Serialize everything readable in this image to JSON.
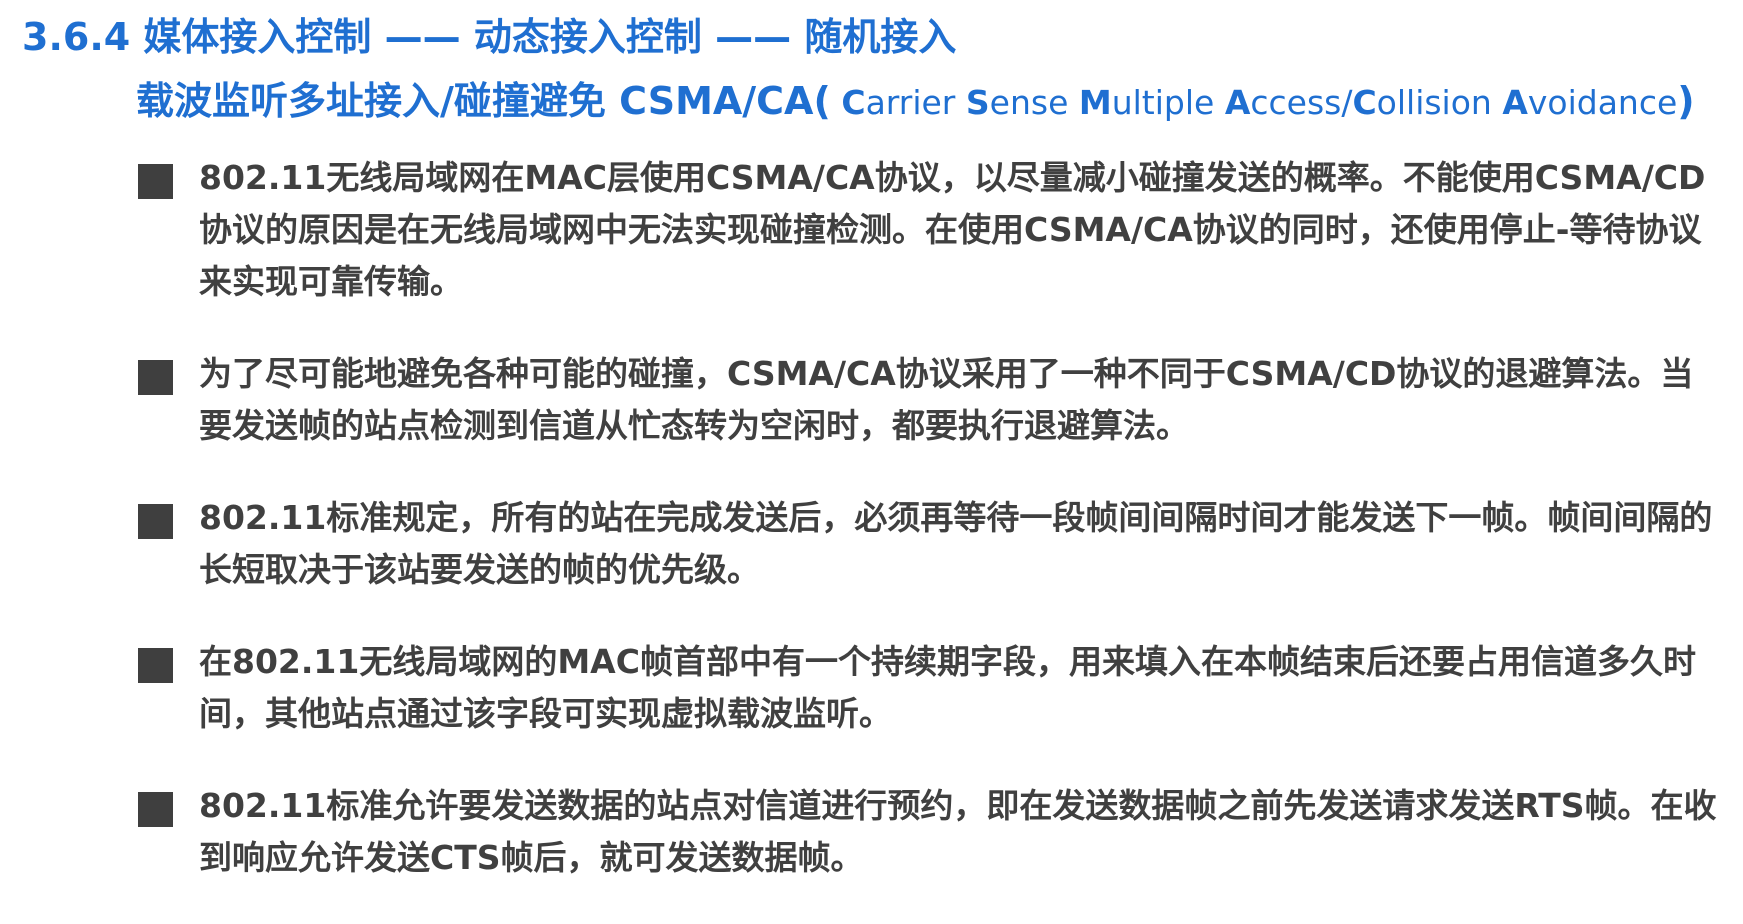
{
  "title": {
    "line1": "3.6.4 媒体接入控制 —— 动态接入控制 —— 随机接入",
    "line2_main": "载波监听多址接入/碰撞避免 CSMA/CA(",
    "line2_expansion": [
      {
        "initial": "C",
        "rest": "arrier "
      },
      {
        "initial": "S",
        "rest": "ense "
      },
      {
        "initial": "M",
        "rest": "ultiple "
      },
      {
        "initial": "A",
        "rest": "ccess/"
      },
      {
        "initial": "C",
        "rest": "ollision "
      },
      {
        "initial": "A",
        "rest": "voidance"
      }
    ],
    "line2_close": ")"
  },
  "bullets": [
    {
      "text": "802.11无线局域网在MAC层使用CSMA/CA协议，以尽量减小碰撞发送的概率。不能使用CSMA/CD协议的原因是在无线局域网中无法实现碰撞检测。在使用CSMA/CA协议的同时，还使用停止-等待协议来实现可靠传输。"
    },
    {
      "text": "为了尽可能地避免各种可能的碰撞，CSMA/CA协议采用了一种不同于CSMA/CD协议的退避算法。当要发送帧的站点检测到信道从忙态转为空闲时，都要执行退避算法。"
    },
    {
      "text": "802.11标准规定，所有的站在完成发送后，必须再等待一段帧间间隔时间才能发送下一帧。帧间间隔的长短取决于该站要发送的帧的优先级。"
    },
    {
      "text": "在802.11无线局域网的MAC帧首部中有一个持续期字段，用来填入在本帧结束后还要占用信道多久时间，其他站点通过该字段可实现虚拟载波监听。"
    },
    {
      "text": "802.11标准允许要发送数据的站点对信道进行预约，即在发送数据帧之前先发送请求发送RTS帧。在收到响应允许发送CTS帧后，就可发送数据帧。"
    }
  ],
  "colors": {
    "title": "#1f6fd1",
    "body_text": "#404040",
    "bullet_marker": "#3f3f3f"
  }
}
